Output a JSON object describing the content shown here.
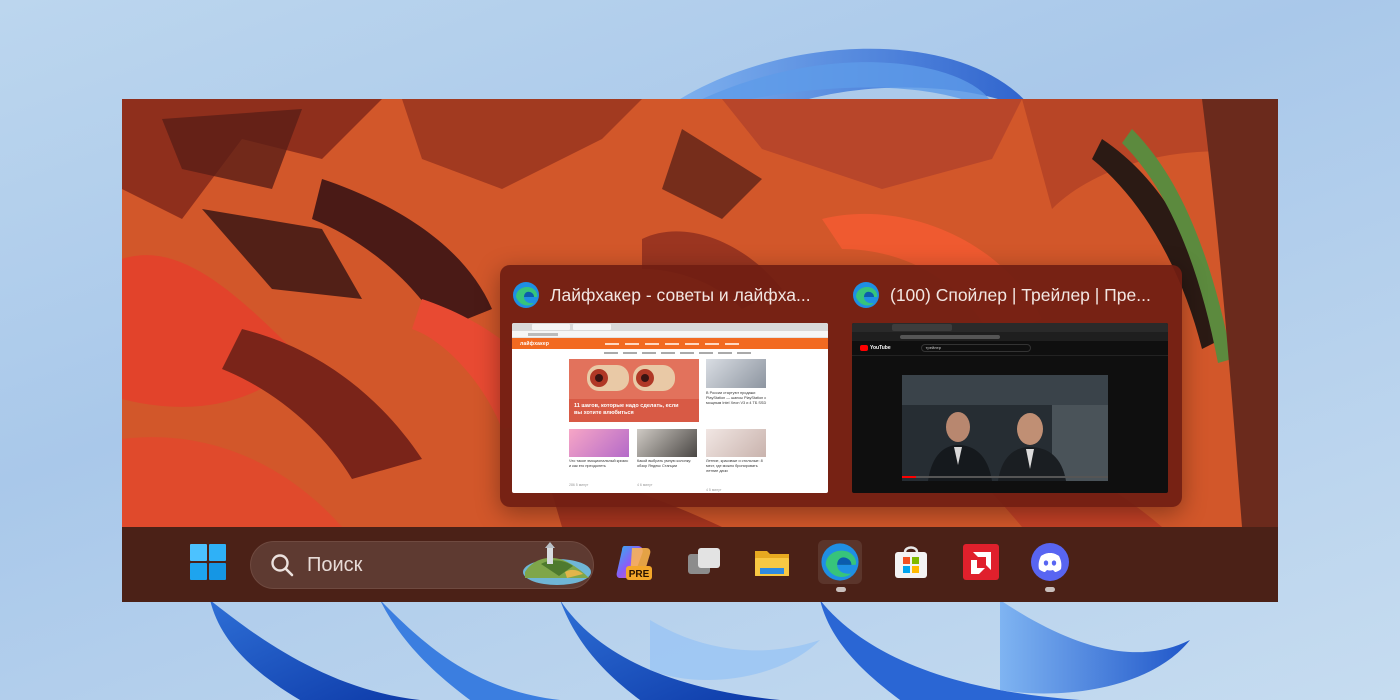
{
  "taskbar": {
    "search": {
      "placeholder": "Поиск"
    },
    "apps": [
      {
        "name": "start",
        "icon": "windows-logo-icon"
      },
      {
        "name": "copilot",
        "icon": "copilot-icon",
        "badge": "PRE"
      },
      {
        "name": "task-view",
        "icon": "task-view-icon"
      },
      {
        "name": "file-explorer",
        "icon": "folder-icon"
      },
      {
        "name": "edge",
        "icon": "edge-icon",
        "active": true
      },
      {
        "name": "microsoft-store",
        "icon": "store-icon"
      },
      {
        "name": "amd-software",
        "icon": "amd-icon"
      },
      {
        "name": "discord",
        "icon": "discord-icon"
      }
    ]
  },
  "preview": {
    "windows": [
      {
        "title": "Лайфхакер - советы и лайфха...",
        "icon": "edge-icon",
        "page": {
          "logo": "лайфхакер",
          "hero_caption": "11 шагов, которые надо сделать, если вы хотите влюбиться",
          "side_text": "В России стартуют продажи PlayStation — шансы PlayStation с мощным Intel Xeon V3 и 4 ТБ SSD",
          "cards": [
            {
              "text": "Что такое эмоциональный кризис и как его преодолеть",
              "meta": "286 5 минут"
            },
            {
              "text": "Какой выбрать умную колонку: обзор Яндекс Станции",
              "meta": "4 6 минут"
            },
            {
              "text": "Летние, красивые и стильные: 8 мест, где можно бронировать летние дачи",
              "meta": "4 5 минут"
            }
          ]
        }
      },
      {
        "title": "(100) Спойлер | Трейлер | Пре...",
        "icon": "edge-icon",
        "page": {
          "logo": "YouTube",
          "search_query": "трейлер"
        }
      }
    ]
  },
  "colors": {
    "taskbar": "#4b2117",
    "flyout": "#701e12",
    "wallpaper": "#d2572a",
    "lifehacker_accent": "#f26a21"
  }
}
